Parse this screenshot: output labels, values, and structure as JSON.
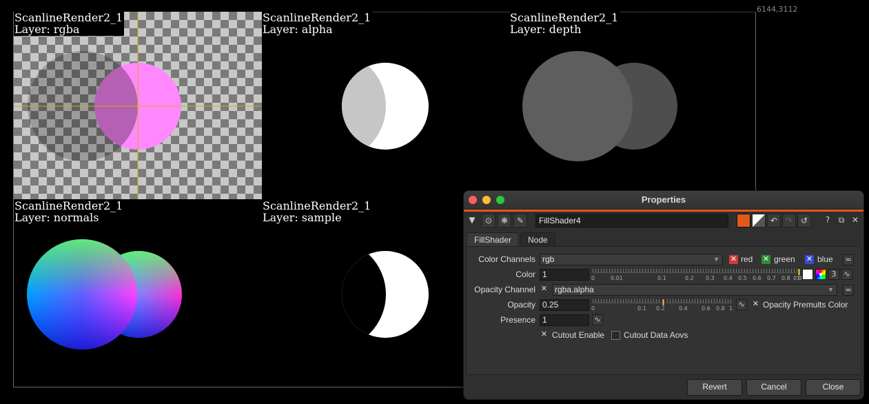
{
  "viewer": {
    "resolution_label": "6144,3112",
    "tiles": [
      {
        "name": "ScanlineRender2_1",
        "layer": "Layer: rgba"
      },
      {
        "name": "ScanlineRender2_1",
        "layer": "Layer: alpha"
      },
      {
        "name": "ScanlineRender2_1",
        "layer": "Layer: depth"
      },
      {
        "name": "ScanlineRender2_1",
        "layer": "Layer: normals"
      },
      {
        "name": "ScanlineRender2_1",
        "layer": "Layer: sample"
      }
    ]
  },
  "panel": {
    "title": "Properties",
    "node_name": "FillShader4",
    "tabs": [
      {
        "label": "FillShader"
      },
      {
        "label": "Node"
      }
    ],
    "color_channels": {
      "label": "Color Channels",
      "value": "rgb",
      "red": "red",
      "green": "green",
      "blue": "blue"
    },
    "color": {
      "label": "Color",
      "value": "1",
      "ticks": [
        "0",
        "0.01",
        "0.1",
        "0.2",
        "0.3",
        "0.4",
        "0.5",
        "0.6",
        "0.7",
        "0.8",
        "0.9",
        "1"
      ],
      "channel_count": "3"
    },
    "opacity_channel": {
      "label": "Opacity Channel",
      "value": "rgba.alpha"
    },
    "opacity": {
      "label": "Opacity",
      "value": "0.25",
      "ticks": [
        "0",
        "0.1",
        "0.2",
        "0.4",
        "0.6",
        "0.8",
        "1"
      ],
      "premult_label": "Opacity Premults Color"
    },
    "presence": {
      "label": "Presence",
      "value": "1"
    },
    "cutout_enable": "Cutout Enable",
    "cutout_data_aovs": "Cutout Data Aovs",
    "buttons": {
      "revert": "Revert",
      "cancel": "Cancel",
      "close": "Close"
    }
  },
  "colors": {
    "accent": "#e2581b",
    "magenta": "#ff80ff"
  }
}
